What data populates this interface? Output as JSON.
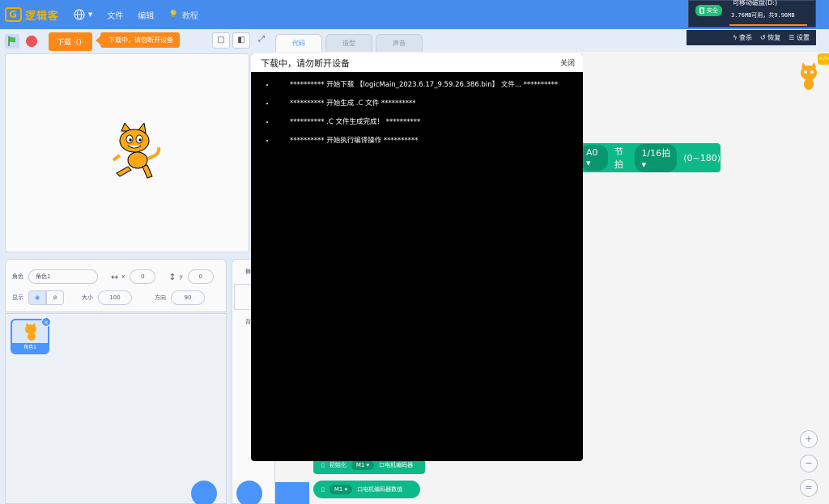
{
  "menubar": {
    "logo_mark": "G",
    "logo_text": "逻辑客",
    "items": [
      {
        "label": "文件"
      },
      {
        "label": "编辑"
      },
      {
        "label": "教程"
      }
    ]
  },
  "stage_toolbar": {
    "download_button": "下载",
    "download_tip": "下载中，请勿断开设备"
  },
  "editor_tabs": [
    {
      "label": "代码"
    },
    {
      "label": "造型"
    },
    {
      "label": "声音"
    }
  ],
  "sprite_info": {
    "sprite_label": "角色",
    "sprite_name": "角色1",
    "x_label": "x",
    "x_value": "0",
    "y_label": "y",
    "y_value": "0",
    "show_label": "显示",
    "size_label": "大小",
    "size_value": "100",
    "direction_label": "方向",
    "direction_value": "90"
  },
  "sprite_list": {
    "items": [
      {
        "name": "角色1"
      }
    ]
  },
  "stage_panel": {
    "label": "舞",
    "backdrop_label": "背"
  },
  "code_blocks": {
    "big_block": {
      "port": "A0",
      "beat_label": "节拍",
      "beat_value": "1/16拍",
      "range": "(0~180)"
    },
    "block1": {
      "label": "初始化",
      "motor": "M1",
      "text": "口电机编码器"
    },
    "block2": {
      "motor": "M1",
      "text": "口电机编码器数值"
    }
  },
  "modal": {
    "title": "下载中，请勿断开设备",
    "close_label": "关闭",
    "log_lines": [
      "********** 开始下载 【logicMain_2023.6.17_9.59.26.386.bin】 文件... **********",
      "********** 开始生成 .C 文件 **********",
      "********** .C 文件生成完成！ **********",
      "********** 开始执行编译操作 **********"
    ]
  },
  "usb_popup": {
    "badge": "安全",
    "title": "可移动磁盘(D:)",
    "space": "3.76MB可用，共9.96MB",
    "tools": [
      {
        "label": "查杀"
      },
      {
        "label": "恢复"
      },
      {
        "label": "设置"
      }
    ]
  },
  "zoom": {
    "zoom_in": "+",
    "zoom_out": "−",
    "reset": "="
  },
  "colors": {
    "menubar": "#4c97ff",
    "download": "#ff8c1a",
    "block": "#0fbd8c",
    "modal_bg": "#000000"
  }
}
